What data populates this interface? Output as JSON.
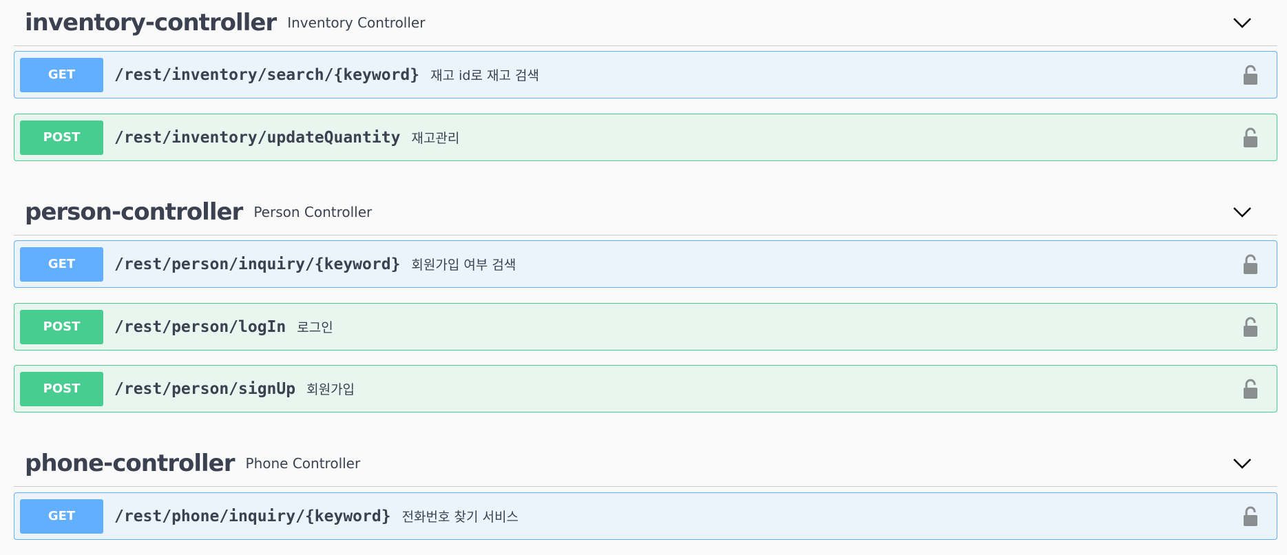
{
  "icons": {
    "chevron": "chevron-down-icon",
    "lock": "unlocked-padlock-icon"
  },
  "colors": {
    "get": "#61affe",
    "post": "#49cc90",
    "text": "#3b4151",
    "lock": "#8b8e8f"
  },
  "sections": [
    {
      "name": "inventory-controller",
      "description": "Inventory Controller",
      "operations": [
        {
          "method": "GET",
          "path": "/rest/inventory/search/{keyword}",
          "summary": "재고 id로 재고 검색"
        },
        {
          "method": "POST",
          "path": "/rest/inventory/updateQuantity",
          "summary": "재고관리"
        }
      ]
    },
    {
      "name": "person-controller",
      "description": "Person Controller",
      "operations": [
        {
          "method": "GET",
          "path": "/rest/person/inquiry/{keyword}",
          "summary": "회원가입 여부 검색"
        },
        {
          "method": "POST",
          "path": "/rest/person/logIn",
          "summary": "로그인"
        },
        {
          "method": "POST",
          "path": "/rest/person/signUp",
          "summary": "회원가입"
        }
      ]
    },
    {
      "name": "phone-controller",
      "description": "Phone Controller",
      "operations": [
        {
          "method": "GET",
          "path": "/rest/phone/inquiry/{keyword}",
          "summary": "전화번호 찾기 서비스"
        }
      ]
    }
  ]
}
